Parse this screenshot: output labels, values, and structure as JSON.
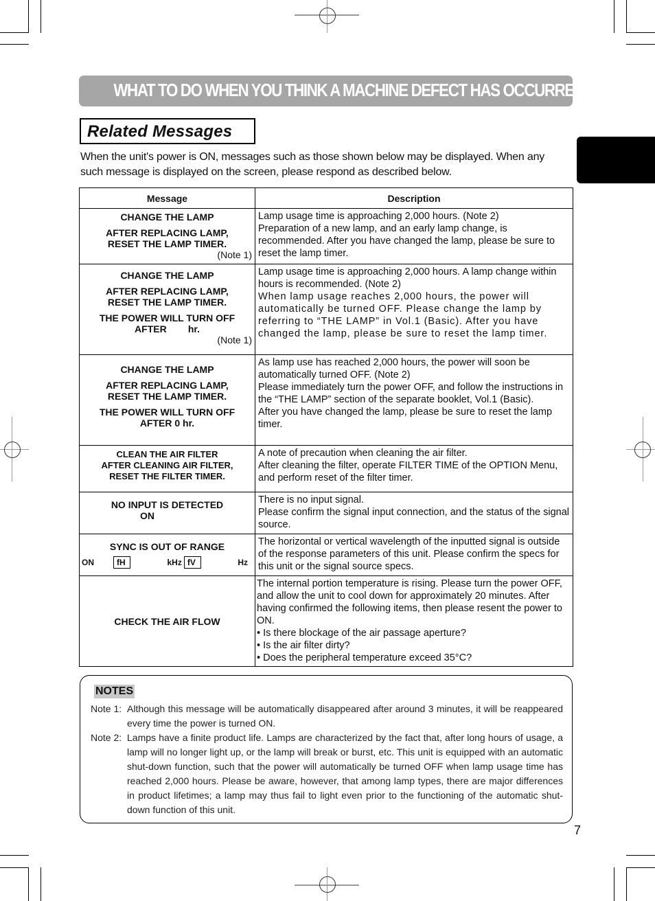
{
  "page": {
    "banner_title": "WHAT TO DO WHEN YOU THINK A MACHINE DEFECT HAS OCCURRED",
    "section_title": "Related Messages",
    "intro": "When the unit's power is ON, messages such as those shown below may be displayed. When any such message is displayed on the screen, please respond as described below.",
    "page_number": "7"
  },
  "table": {
    "headers": {
      "message": "Message",
      "description": "Description"
    },
    "rows": [
      {
        "message": [
          "CHANGE THE LAMP",
          "AFTER REPLACING LAMP,",
          "RESET THE LAMP TIMER."
        ],
        "note": "(Note 1)",
        "description": [
          "Lamp usage time is approaching 2,000 hours. (Note 2)",
          "Preparation of a new lamp, and an early lamp change, is recommended. After you have changed the lamp, please be sure to reset the lamp timer."
        ]
      },
      {
        "message": [
          "CHANGE THE LAMP",
          "AFTER REPLACING LAMP,",
          "RESET THE LAMP TIMER.",
          "THE POWER WILL TURN OFF",
          "AFTER        hr."
        ],
        "note": "(Note 1)",
        "description": [
          "Lamp usage time is approaching 2,000 hours. A lamp change within         hours is recommended. (Note 2)",
          "When lamp usage reaches 2,000 hours, the power will automatically be turned OFF. Please change the lamp by referring to “THE LAMP” in Vol.1 (Basic). After you have changed the lamp, please be sure to reset the lamp timer."
        ]
      },
      {
        "message": [
          "CHANGE THE LAMP",
          "AFTER REPLACING LAMP,",
          "RESET THE LAMP TIMER.",
          "THE POWER WILL TURN OFF",
          "AFTER 0 hr."
        ],
        "description": [
          "As lamp use has reached 2,000 hours, the power will soon be automatically turned OFF. (Note 2)",
          "Please immediately turn the power OFF, and follow the instructions in the “THE LAMP” section of the separate booklet, Vol.1 (Basic).",
          "After you have changed the lamp, please be sure to reset the lamp timer."
        ]
      },
      {
        "message": [
          "CLEAN THE AIR FILTER",
          "AFTER CLEANING AIR FILTER,",
          "RESET THE FILTER TIMER."
        ],
        "description": [
          "A note of precaution when cleaning the air filter.",
          "After cleaning the filter, operate FILTER TIME of the OPTION Menu, and perform reset of the filter timer."
        ]
      },
      {
        "message": [
          "NO INPUT IS DETECTED",
          "ON"
        ],
        "description": [
          "There is no input signal.",
          "Please confirm the signal input connection, and the status of the signal source."
        ]
      },
      {
        "message": [
          "SYNC IS OUT OF RANGE"
        ],
        "sync_line": {
          "on": "ON",
          "fh": "fH",
          "khz": "kHz",
          "fv": "fV",
          "hz": "Hz"
        },
        "description": [
          "The horizontal or vertical wavelength of the inputted signal is outside of the response parameters of this unit. Please confirm the specs for this unit or the signal source specs."
        ]
      },
      {
        "message": [
          "CHECK THE AIR FLOW"
        ],
        "description": [
          "The internal portion temperature is rising. Please turn the power OFF, and allow the unit to cool down for approximately 20 minutes. After having confirmed the following items, then please resent the power to ON.",
          "• Is there blockage of the air passage aperture?",
          "• Is the air filter dirty?",
          "• Does the peripheral temperature exceed 35°C?"
        ]
      }
    ]
  },
  "notes": {
    "heading": "NOTES",
    "items": [
      {
        "label": "Note 1:",
        "text": "Although this message will be automatically disappeared after around 3 minutes, it will be reappeared every time the power is turned ON."
      },
      {
        "label": "Note 2:",
        "text": "Lamps have a finite product life. Lamps are characterized by the fact that, after long hours of usage, a lamp will no longer light up, or the lamp will break or burst, etc. This unit is equipped with an automatic shut-down function, such that the power will automatically be turned OFF when lamp usage time has reached 2,000 hours. Please be aware, however, that among lamp types, there are major differences in product lifetimes; a lamp may thus fail to light even prior to the functioning of the automatic shut-down function of this unit."
      }
    ]
  }
}
